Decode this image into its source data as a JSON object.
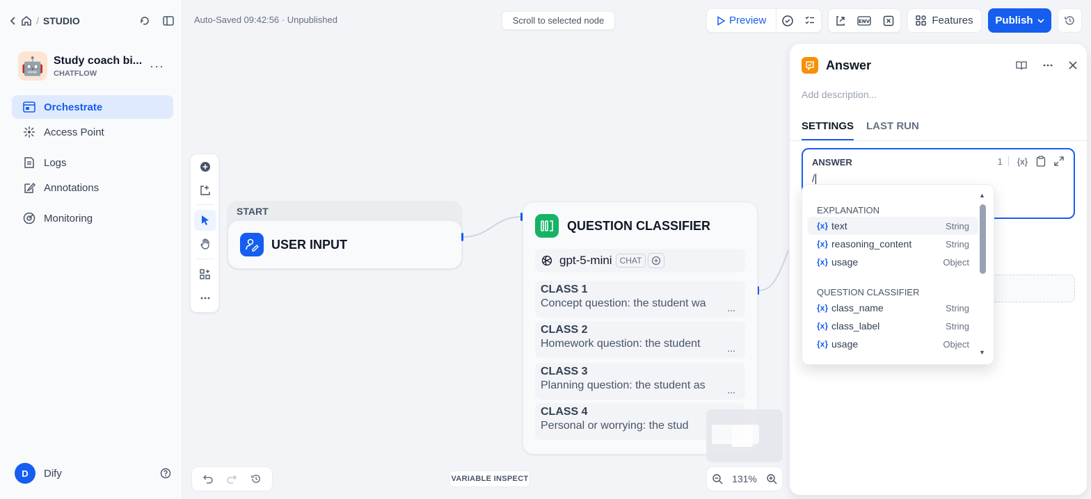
{
  "sidebar": {
    "breadcrumb": "STUDIO",
    "app": {
      "name": "Study coach bi...",
      "type": "CHATFLOW",
      "avatar": "🤖"
    },
    "nav": [
      {
        "label": "Orchestrate",
        "active": true,
        "icon": "orchestrate-icon"
      },
      {
        "label": "Access Point",
        "active": false,
        "icon": "access-point-icon"
      },
      {
        "label": "Logs",
        "active": false,
        "icon": "logs-icon"
      },
      {
        "label": "Annotations",
        "active": false,
        "icon": "annotations-icon"
      },
      {
        "label": "Monitoring",
        "active": false,
        "icon": "monitoring-icon"
      }
    ],
    "user": {
      "initial": "D",
      "name": "Dify"
    }
  },
  "topbar": {
    "autosave": "Auto-Saved 09:42:56 · Unpublished",
    "scroll_to_selected": "Scroll to selected node",
    "preview": "Preview",
    "features": "Features",
    "publish": "Publish"
  },
  "canvas": {
    "start_group_label": "START",
    "start_node_title": "USER INPUT",
    "classifier": {
      "title": "QUESTION CLASSIFIER",
      "model": "gpt-5-mini",
      "model_mode": "CHAT",
      "classes": [
        {
          "name": "CLASS 1",
          "desc": "Concept question: the student wa"
        },
        {
          "name": "CLASS 2",
          "desc": "Homework question: the student"
        },
        {
          "name": "CLASS 3",
          "desc": "Planning question: the student as"
        },
        {
          "name": "CLASS 4",
          "desc": "Personal or worrying: the stud"
        }
      ],
      "ellipsis": "..."
    },
    "variable_inspect": "VARIABLE INSPECT",
    "zoom": "131%"
  },
  "panel": {
    "title": "Answer",
    "description_placeholder": "Add description...",
    "tabs": [
      "SETTINGS",
      "LAST RUN"
    ],
    "answer": {
      "label": "ANSWER",
      "char_count": "1",
      "value": "/",
      "var_token": "{x}"
    }
  },
  "variable_dropdown": {
    "groups": [
      {
        "title": "EXPLANATION",
        "items": [
          {
            "name": "text",
            "type": "String",
            "highlight": true
          },
          {
            "name": "reasoning_content",
            "type": "String",
            "highlight": false
          },
          {
            "name": "usage",
            "type": "Object",
            "highlight": false
          }
        ]
      },
      {
        "title": "QUESTION CLASSIFIER",
        "items": [
          {
            "name": "class_name",
            "type": "String",
            "highlight": false
          },
          {
            "name": "class_label",
            "type": "String",
            "highlight": false
          },
          {
            "name": "usage",
            "type": "Object",
            "highlight": false
          }
        ]
      }
    ],
    "var_prefix": "{x}"
  },
  "colors": {
    "accent": "#155eef",
    "answer_icon": "#f79009",
    "classifier_icon": "#16b364"
  }
}
